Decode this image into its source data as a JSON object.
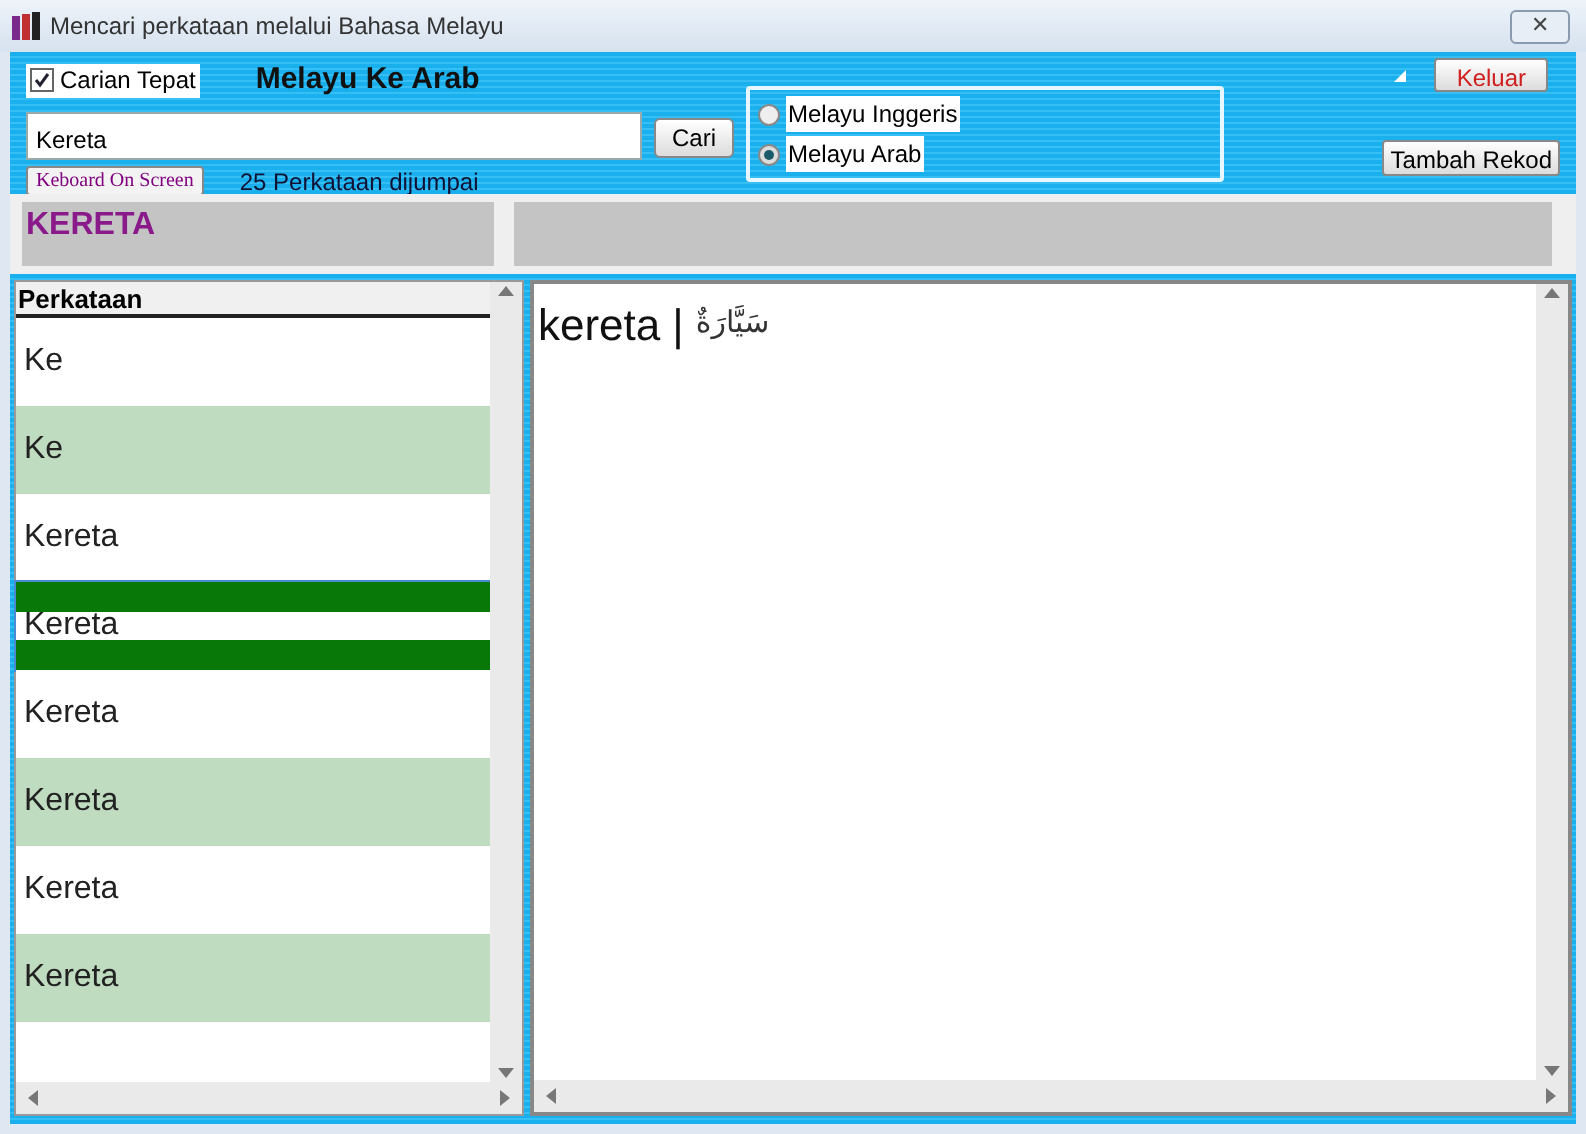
{
  "window": {
    "title": "Mencari perkataan melalui Bahasa Melayu",
    "close": "✕"
  },
  "exact_search": {
    "label": "Carian Tepat",
    "checked": true
  },
  "mode_title": "Melayu Ke Arab",
  "search": {
    "value": "Kereta"
  },
  "search_button": "Cari",
  "languages": [
    {
      "label": "Melayu Inggeris",
      "selected": false
    },
    {
      "label": "Melayu Arab",
      "selected": true
    }
  ],
  "exit_button": "Keluar",
  "add_button": "Tambah Rekod",
  "keyboard_button": "Keboard  On Screen",
  "result_count": "25 Perkataan dijumpai",
  "current_word": "KERETA",
  "list": {
    "header": "Perkataan",
    "rows": [
      {
        "text": "Ke",
        "selected": false
      },
      {
        "text": "Ke",
        "selected": false
      },
      {
        "text": "Kereta",
        "selected": false
      },
      {
        "text": "Kereta",
        "selected": true
      },
      {
        "text": "Kereta",
        "selected": false
      },
      {
        "text": "Kereta",
        "selected": false
      },
      {
        "text": "Kereta",
        "selected": false
      },
      {
        "text": "Kereta",
        "selected": false
      }
    ]
  },
  "definition": {
    "word": "kereta",
    "separator": "|",
    "arabic": "سَيَّارَةٌ"
  }
}
